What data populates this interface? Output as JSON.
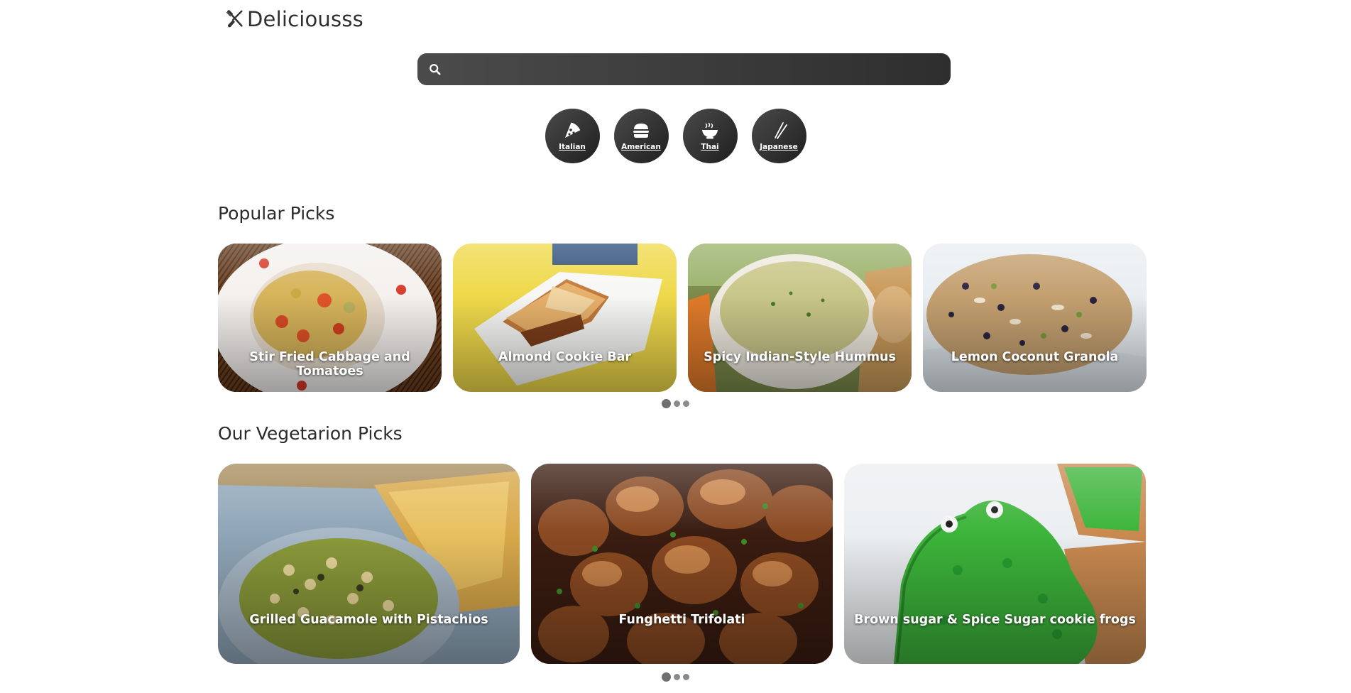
{
  "brand": {
    "name": "Deliciousss",
    "icon": "fork-knife-icon"
  },
  "search": {
    "placeholder": "",
    "value": "",
    "icon": "search-icon"
  },
  "categories": [
    {
      "label": "Italian",
      "icon": "pizza-icon"
    },
    {
      "label": "American",
      "icon": "burger-icon"
    },
    {
      "label": "Thai",
      "icon": "noodle-bowl-icon"
    },
    {
      "label": "Japanese",
      "icon": "chopsticks-icon"
    }
  ],
  "popular": {
    "title": "Popular Picks",
    "items": [
      {
        "title": "Stir Fried Cabbage and Tomatoes"
      },
      {
        "title": "Almond Cookie Bar"
      },
      {
        "title": "Spicy Indian-Style Hummus"
      },
      {
        "title": "Lemon Coconut Granola"
      }
    ],
    "pages": 3,
    "current_page": 1
  },
  "vegetarian": {
    "title": "Our Vegetarion Picks",
    "items": [
      {
        "title": "Grilled Guacamole with Pistachios"
      },
      {
        "title": "Funghetti Trifolati"
      },
      {
        "title": "Brown sugar & Spice Sugar cookie frogs"
      }
    ],
    "pages": 3,
    "current_page": 1
  },
  "colors": {
    "text": "#2b2b2b",
    "category_bg": "#2e2e2e",
    "search_bg": "#3a3a3a"
  }
}
